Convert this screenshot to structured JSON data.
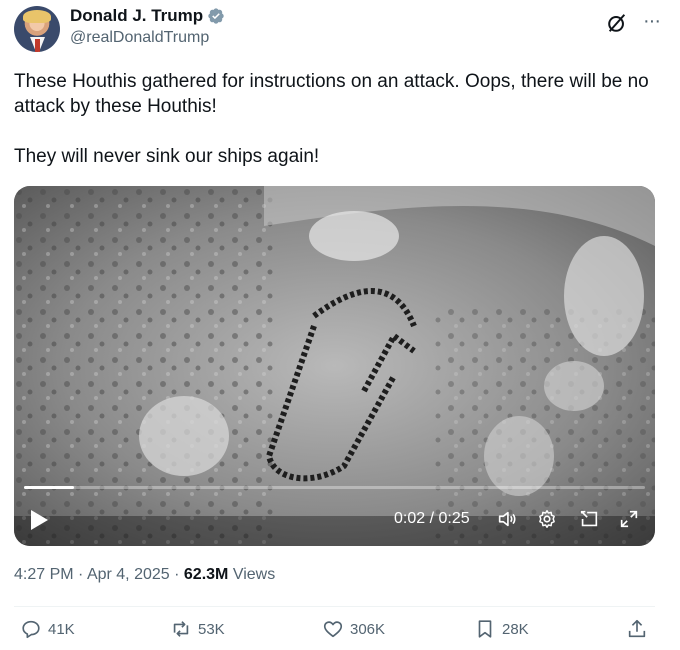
{
  "author": {
    "display_name": "Donald J. Trump",
    "handle": "@realDonaldTrump",
    "verified": true
  },
  "icons": {
    "avatar": "profile-photo",
    "verified": "verified-badge-icon",
    "grok": "grok-icon",
    "more": "more-icon"
  },
  "post": {
    "paragraph1": "These Houthis gathered for instructions on an attack. Oops, there will be no attack by these Houthis!",
    "paragraph2": "They will never sink our ships again!"
  },
  "video": {
    "time_display": "0:02 / 0:25",
    "progress": 0.08
  },
  "meta": {
    "time": "4:27 PM",
    "sep1": "·",
    "date": "Apr 4, 2025",
    "sep2": "·",
    "views_count": "62.3M",
    "views_label": "Views"
  },
  "actions": {
    "replies": "41K",
    "reposts": "53K",
    "likes": "306K",
    "bookmarks": "28K"
  },
  "colors": {
    "text": "#0f1419",
    "secondary": "#536471",
    "verified": "#829aab"
  }
}
